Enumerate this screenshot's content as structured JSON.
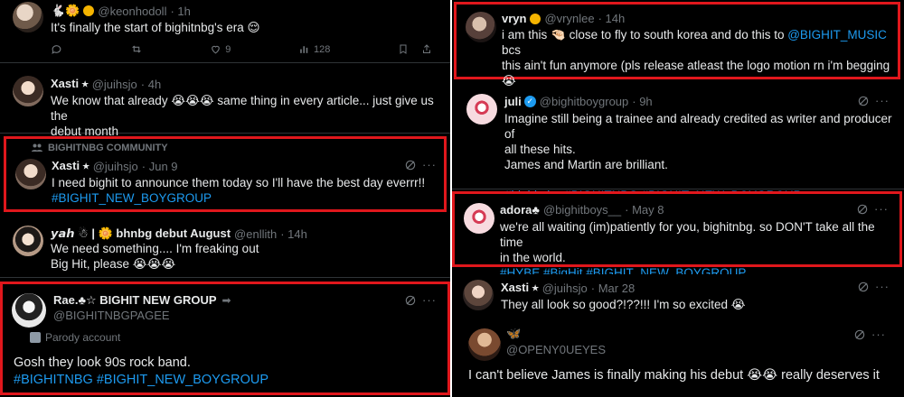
{
  "left": {
    "t1": {
      "name": "🐇🌼",
      "handle": "@keonhodoll",
      "time": "· 1h",
      "text": "It's finally the start of bighitnbg's era 😌",
      "likes": "9",
      "views": "128"
    },
    "t2": {
      "name": "Xasti ⭑",
      "handle": "@juihsjo",
      "time": "· 4h",
      "text_line1": "We know that already 😭😭😭 same thing in every article... just give us the",
      "text_line2": "debut month"
    },
    "t3": {
      "community": "BIGHITNBG COMMUNITY",
      "name": "Xasti ⭑",
      "handle": "@juihsjo",
      "time": "· Jun 9",
      "text": "I need bighit to announce them today so I'll have the best day everrr!!",
      "tags": "#BIGHIT_NEW_BOYGROUP"
    },
    "t4": {
      "name": "𝙮𝙖𝙝 ☃ | 🌼 bhnbg debut August",
      "handle": "@enllith",
      "time": "· 14h",
      "text_line1": "We need something.... I'm freaking out",
      "text_line2": "Big Hit, please 😭😭😭"
    },
    "t5": {
      "name": "Rae.♣☆ BIGHIT NEW GROUP",
      "handle": "@BIGHITNBGPAGEE",
      "parody": "Parody account",
      "text": "Gosh they look 90s rock band.",
      "tags": "#BIGHITNBG #BIGHIT_NEW_BOYGROUP"
    }
  },
  "right": {
    "t1": {
      "name": "vryn",
      "handle": "@vrynlee",
      "time": "· 14h",
      "text_line1_a": "i am this 🤏🏻 close to fly to south korea and do this to ",
      "mention": "@BIGHIT_MUSIC",
      "text_line1_b": " bcs",
      "text_line2": "this ain't fun anymore (pls release atleast the logo motion rn i'm begging 😭",
      "text_line3": ")"
    },
    "t2": {
      "name": "juli",
      "handle": "@bighitboygroup",
      "time": "· 9h",
      "text_line1": "Imagine still being a trainee and already credited as writer and producer of",
      "text_line2": "all these hits.",
      "text_line3": "James and Martin are brilliant.",
      "tags": "#bighitnbg #BIGHITNBG #BIGHIT_NEW_BOYGROUP"
    },
    "t3": {
      "name": "adora♣",
      "handle": "@bighitboys__",
      "time": "· May 8",
      "text_line1": "we're all waiting (im)patiently for you, bighitnbg. so DON'T take all the time",
      "text_line2": "in the world.",
      "tags": "#HYBE #BigHit #BIGHIT_NEW_BOYGROUP"
    },
    "t4": {
      "name": "Xasti ⭑",
      "handle": "@juihsjo",
      "time": "· Mar 28",
      "text": "They all look so good?!??!!! I'm so excited 😭"
    },
    "t5": {
      "name": "🦋",
      "handle": "@OPENY0UEYES",
      "text": "I can't believe James is finally making his debut 😭😭 really deserves it"
    }
  },
  "colors": {
    "background": "#000000",
    "text": "#e7e9ea",
    "muted": "#71767b",
    "link": "#1d9bf0",
    "highlight_border": "#e0171c"
  }
}
